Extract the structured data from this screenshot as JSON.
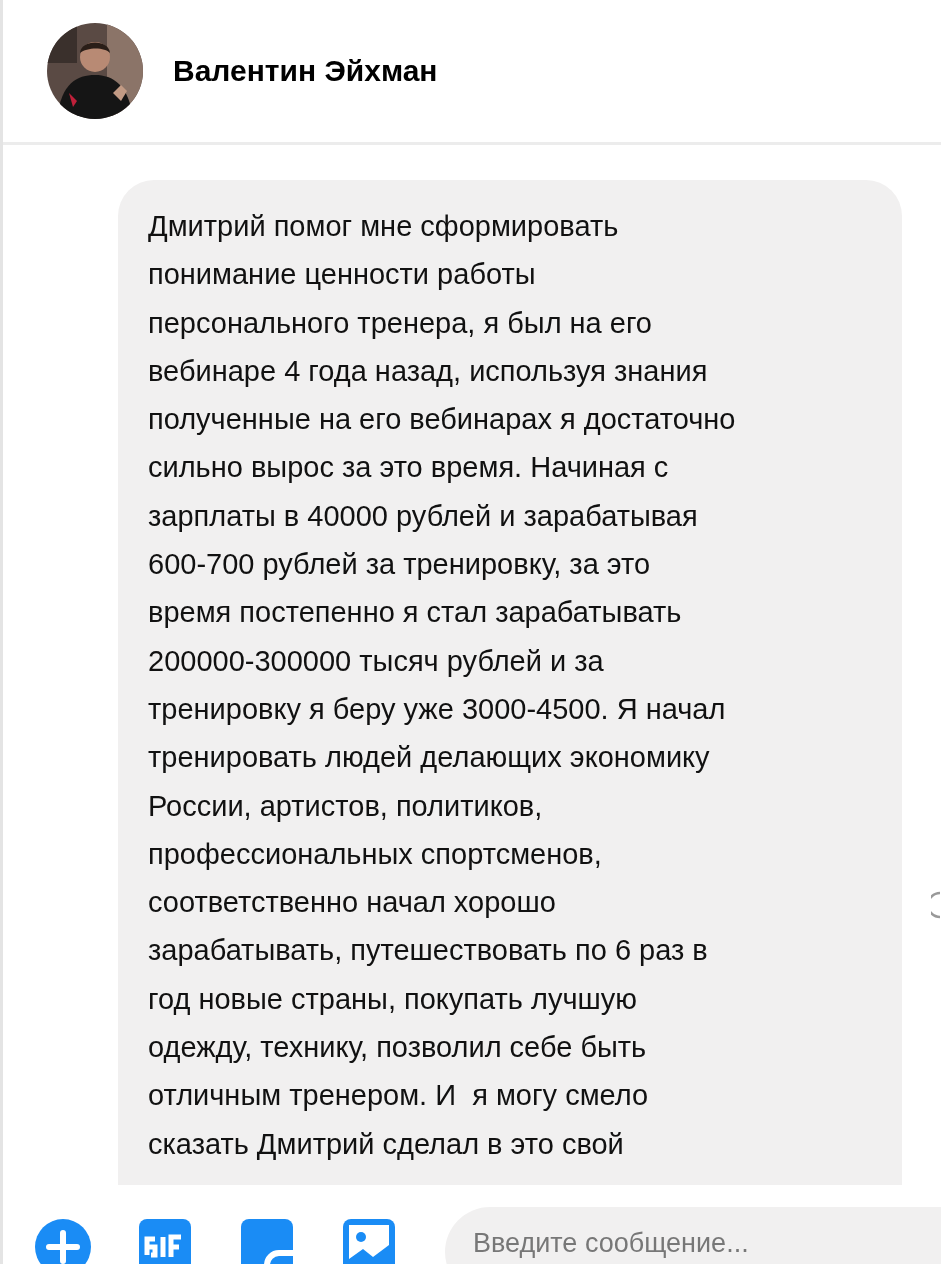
{
  "header": {
    "contact_name": "Валентин Эйхман"
  },
  "messages": [
    {
      "kind": "incoming",
      "lines": [
        "Дмитрий помог мне сформировать",
        "понимание ценности работы",
        "персонального тренера, я был на его",
        "вебинаре 4 года назад, используя знания",
        "полученные на его вебинарах я достаточно",
        "сильно вырос за это время. Начиная с",
        "зарплаты в 40000 рублей и зарабатывая",
        "600-700 рублей за тренировку, за это",
        "время постепенно я стал зарабатывать",
        "200000-300000 тысяч рублей и за",
        "тренировку я беру уже 3000-4500. Я начал",
        "тренировать людей делающих экономику",
        "России, артистов, политиков,",
        "профессиональных спортсменов,",
        "соответственно начал хорошо",
        "зарабатывать, путешествовать по 6 раз в",
        "год новые страны, покупать лучшую",
        "одежду, технику, позволил себе быть",
        "отличным тренером. И  я могу смело",
        "сказать Дмитрий сделал в это свой"
      ]
    }
  ],
  "composer": {
    "placeholder": "Введите сообщение..."
  }
}
